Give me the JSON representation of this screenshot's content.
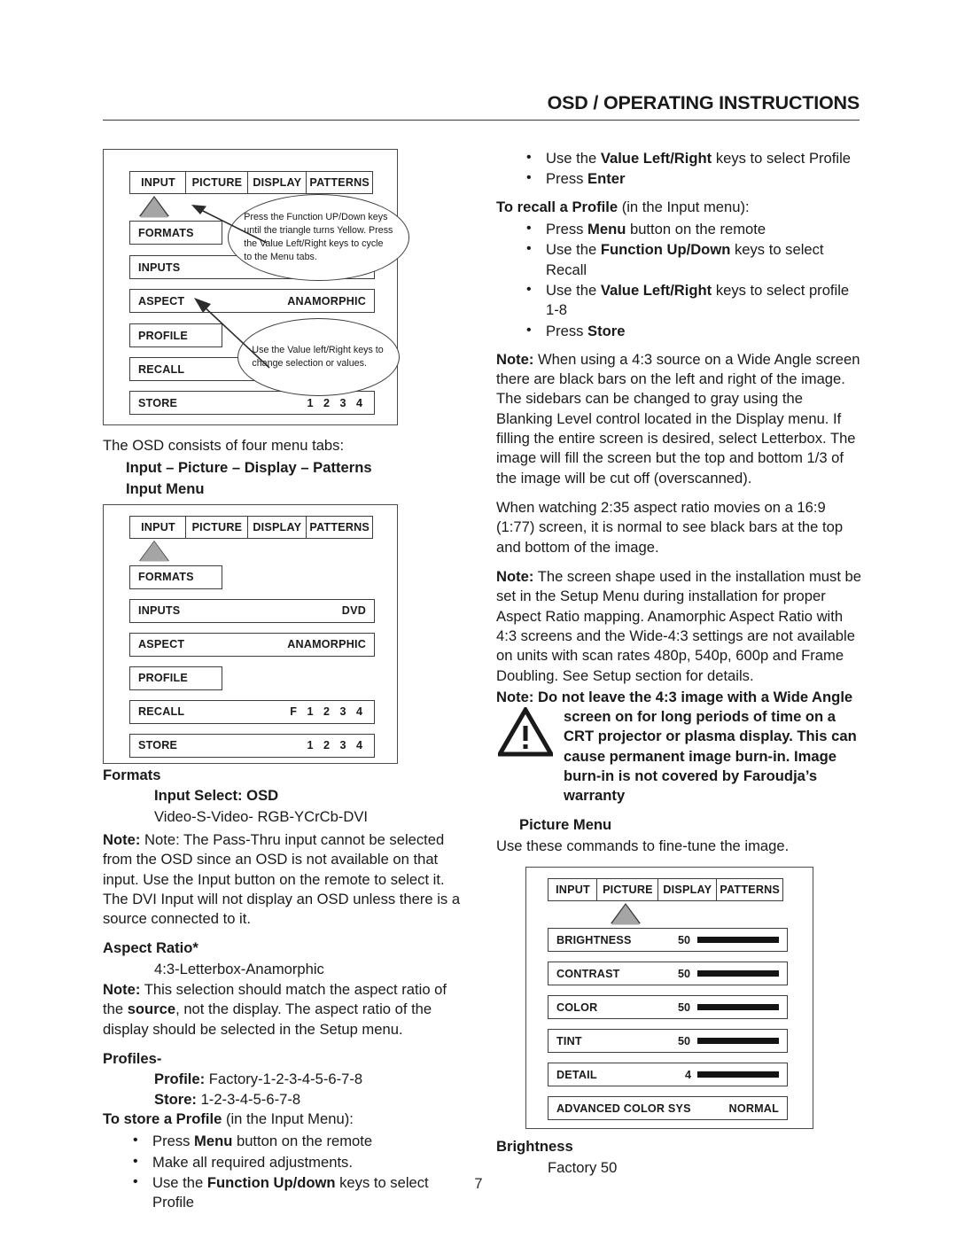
{
  "header": {
    "title": "OSD / OPERATING INSTRUCTIONS"
  },
  "page_number": "7",
  "osd_menu_annotated": {
    "tabs": [
      "INPUT",
      "PICTURE",
      "DISPLAY",
      "PATTERNS"
    ],
    "rows": [
      {
        "label": "FORMATS",
        "value": ""
      },
      {
        "label": "INPUTS",
        "value": ""
      },
      {
        "label": "ASPECT",
        "value": "ANAMORPHIC"
      },
      {
        "label": "PROFILE",
        "value": ""
      },
      {
        "label": "RECALL",
        "value": ""
      },
      {
        "label": "STORE",
        "value": "1 2 3 4"
      }
    ],
    "callout_1": "Press the Function UP/Down keys until the triangle turns Yellow. Press the Value Left/Right keys to cycle to the Menu tabs.",
    "callout_2": "Use the Value left/Right keys to change selection or values."
  },
  "left": {
    "intro": "The OSD consists of four menu tabs:",
    "tabs_line": "Input – Picture – Display – Patterns",
    "input_menu_heading": "Input Menu",
    "formats_heading": "Formats",
    "input_select": "Input Select: OSD",
    "input_select_values": "Video-S-Video- RGB-YCrCb-DVI",
    "note1_label": "Note:",
    "note1_text": " Note: The Pass-Thru input cannot be selected from the OSD since an OSD is not available on that input. Use the Input button on the remote to select it. The DVI Input will not display an OSD unless there is a source connected to it.",
    "aspect_ratio_heading": "Aspect Ratio*",
    "aspect_ratio_values": "4:3-Letterbox-Anamorphic",
    "note2_label": "Note:",
    "note2_part1": " This selection should match the aspect ratio of the ",
    "note2_bold": "source",
    "note2_part2": ", not the display.  The aspect ratio of the display should be selected in the Setup menu.",
    "profiles_heading": "Profiles-",
    "profile_label": "Profile:",
    "profile_values": " Factory-1-2-3-4-5-6-7-8",
    "store_label": "Store:",
    "store_values": " 1-2-3-4-5-6-7-8",
    "store_profile_head_bold": "To store a Profile",
    "store_profile_head_rest": " (in the Input Menu):",
    "store_bullets": [
      {
        "pre": "Press ",
        "bold": "Menu",
        "post": " button on the remote"
      },
      {
        "pre": "Make all required adjustments.",
        "bold": "",
        "post": ""
      },
      {
        "pre": "Use the ",
        "bold": "Function Up/down",
        "post": " keys to select  Profile"
      }
    ]
  },
  "osd_input_menu": {
    "tabs": [
      "INPUT",
      "PICTURE",
      "DISPLAY",
      "PATTERNS"
    ],
    "rows": [
      {
        "label": "FORMATS",
        "value": ""
      },
      {
        "label": "INPUTS",
        "value": "DVD"
      },
      {
        "label": "ASPECT",
        "value": "ANAMORPHIC"
      },
      {
        "label": "PROFILE",
        "value": ""
      },
      {
        "label": "RECALL",
        "value": "F 1 2 3 4"
      },
      {
        "label": "STORE",
        "value": "1 2 3 4"
      }
    ]
  },
  "right": {
    "top_bullets": [
      {
        "pre": "Use the ",
        "bold": "Value Left/Right",
        "post": " keys to select Profile"
      },
      {
        "pre": "Press ",
        "bold": "Enter",
        "post": ""
      }
    ],
    "recall_head_bold": "To recall a Profile",
    "recall_head_rest": " (in the Input menu):",
    "recall_bullets": [
      {
        "pre": "Press ",
        "bold": "Menu",
        "post": " button on the remote"
      },
      {
        "pre": "Use the ",
        "bold": "Function Up/Down",
        "post": " keys to select Recall"
      },
      {
        "pre": "Use the ",
        "bold": "Value Left/Right",
        "post": " keys to select profile 1-8"
      },
      {
        "pre": "Press ",
        "bold": "Store",
        "post": ""
      }
    ],
    "note3_label": "Note:",
    "note3_text": " When using a 4:3 source on a Wide Angle screen there are black bars on the left and right of the image. The sidebars can be changed to gray using the Blanking Level control located in the Display menu.  If filling the entire screen is desired, select Letterbox.  The image will fill the screen but the top and bottom 1/3 of the image will be cut off (overscanned).",
    "para_235": "When watching 2:35 aspect ratio movies on a 16:9 (1:77) screen, it is normal to see black bars at the top and bottom of the image.",
    "note4_label": "Note:",
    "note4_text": " The screen shape used in the installation must be set in the Setup Menu during installation for proper Aspect Ratio mapping. Anamorphic Aspect Ratio with 4:3 screens and the Wide-4:3 settings are not available on units with scan rates 480p, 540p, 600p and Frame Doubling. See Setup section for details.",
    "warning_lead": "Note: Do not leave the 4:3 image with a Wide Angle",
    "warning_body": "screen on for long periods of time on a CRT projector or plasma display. This can cause permanent image burn-in.  Image burn-in is not covered by Faroudja’s warranty",
    "picture_menu_heading": "Picture Menu",
    "picture_menu_intro": "Use these commands to fine-tune the image.",
    "brightness_heading": "Brightness",
    "brightness_value": "Factory 50"
  },
  "osd_picture_menu": {
    "tabs": [
      "INPUT",
      "PICTURE",
      "DISPLAY",
      "PATTERNS"
    ],
    "rows": [
      {
        "label": "BRIGHTNESS",
        "value": "50",
        "bar": true
      },
      {
        "label": "CONTRAST",
        "value": "50",
        "bar": true
      },
      {
        "label": "COLOR",
        "value": "50",
        "bar": true
      },
      {
        "label": "TINT",
        "value": "50",
        "bar": true
      },
      {
        "label": "DETAIL",
        "value": "4",
        "bar": true
      },
      {
        "label": "ADVANCED COLOR SYS",
        "value": "NORMAL",
        "bar": false
      }
    ]
  },
  "colors": {
    "ink": "#1a1a1a",
    "rule": "#3a3a3a",
    "box_border": "#3d3d3d",
    "triangle_fill": "#a5a5a5",
    "meter_fill": "#141414"
  }
}
